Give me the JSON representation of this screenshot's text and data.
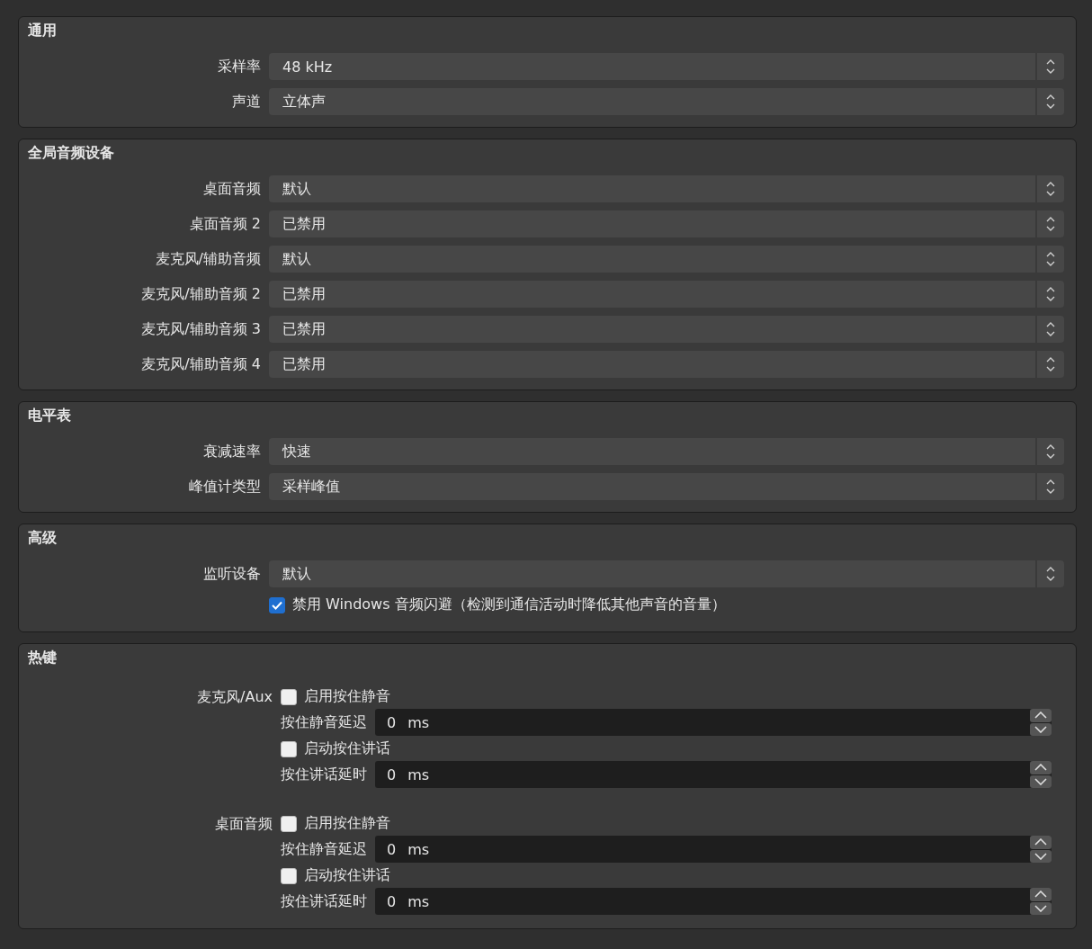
{
  "groups": [
    {
      "title": "通用",
      "kind": "form",
      "rows": [
        {
          "kind": "select",
          "label": "采样率",
          "value": "48 kHz"
        },
        {
          "kind": "select",
          "label": "声道",
          "value": "立体声"
        }
      ]
    },
    {
      "title": "全局音频设备",
      "kind": "form",
      "rows": [
        {
          "kind": "select",
          "label": "桌面音频",
          "value": "默认"
        },
        {
          "kind": "select",
          "label": "桌面音频 2",
          "value": "已禁用"
        },
        {
          "kind": "select",
          "label": "麦克风/辅助音频",
          "value": "默认"
        },
        {
          "kind": "select",
          "label": "麦克风/辅助音频 2",
          "value": "已禁用"
        },
        {
          "kind": "select",
          "label": "麦克风/辅助音频 3",
          "value": "已禁用"
        },
        {
          "kind": "select",
          "label": "麦克风/辅助音频 4",
          "value": "已禁用"
        }
      ]
    },
    {
      "title": "电平表",
      "kind": "form",
      "rows": [
        {
          "kind": "select",
          "label": "衰减速率",
          "value": "快速"
        },
        {
          "kind": "select",
          "label": "峰值计类型",
          "value": "采样峰值"
        }
      ]
    },
    {
      "title": "高级",
      "kind": "form",
      "rows": [
        {
          "kind": "select",
          "label": "监听设备",
          "value": "默认"
        },
        {
          "kind": "checkbox",
          "label": "禁用 Windows 音频闪避（检测到通信活动时降低其他声音的音量）",
          "checked": true
        }
      ]
    },
    {
      "title": "热键",
      "kind": "hotkeys",
      "items": [
        {
          "label": "麦克风/Aux",
          "controls": [
            {
              "kind": "checkbox",
              "label": "启用按住静音",
              "checked": false
            },
            {
              "kind": "spin",
              "label": "按住静音延迟",
              "value": "0 ms"
            },
            {
              "kind": "checkbox",
              "label": "启动按住讲话",
              "checked": false
            },
            {
              "kind": "spin",
              "label": "按住讲话延时",
              "value": "0 ms"
            }
          ]
        },
        {
          "label": "桌面音频",
          "controls": [
            {
              "kind": "checkbox",
              "label": "启用按住静音",
              "checked": false
            },
            {
              "kind": "spin",
              "label": "按住静音延迟",
              "value": "0 ms"
            },
            {
              "kind": "checkbox",
              "label": "启动按住讲话",
              "checked": false
            },
            {
              "kind": "spin",
              "label": "按住讲话延时",
              "value": "0 ms"
            }
          ]
        }
      ]
    }
  ]
}
